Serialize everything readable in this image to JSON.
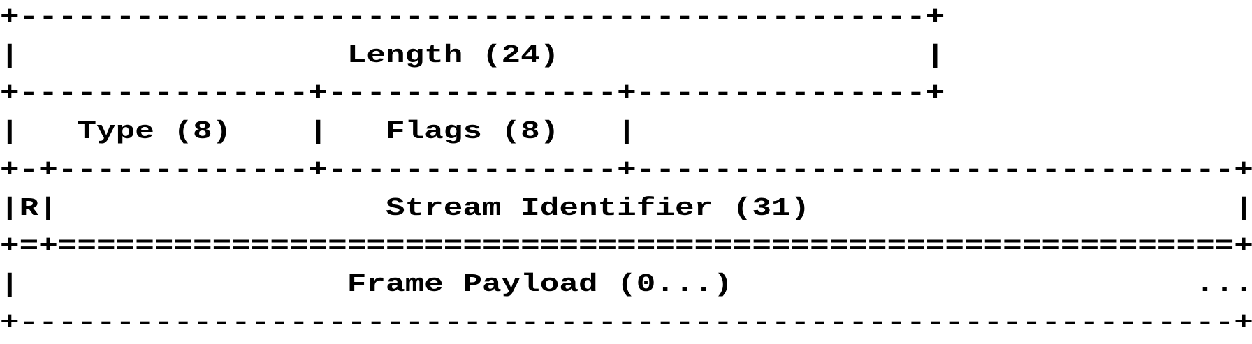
{
  "diagram": {
    "title": "",
    "lines": [
      "+-----------------------------------------------+",
      "|                 Length (24)                   |",
      "+---------------+---------------+---------------+",
      "|   Type (8)    |   Flags (8)   |",
      "+-+-------------+---------------+-------------------------------+",
      "|R|                 Stream Identifier (31)                      |",
      "+=+=============================================================+",
      "|                 Frame Payload (0...)                        ...",
      "+---------------------------------------------------------------+"
    ],
    "fields": [
      {
        "name": "Length",
        "bits": "24"
      },
      {
        "name": "Type",
        "bits": "8"
      },
      {
        "name": "Flags",
        "bits": "8"
      },
      {
        "name": "R",
        "bits": ""
      },
      {
        "name": "Stream Identifier",
        "bits": "31"
      },
      {
        "name": "Frame Payload",
        "bits": "0..."
      }
    ],
    "text_color": "#000000",
    "background_color": "#ffffff"
  }
}
